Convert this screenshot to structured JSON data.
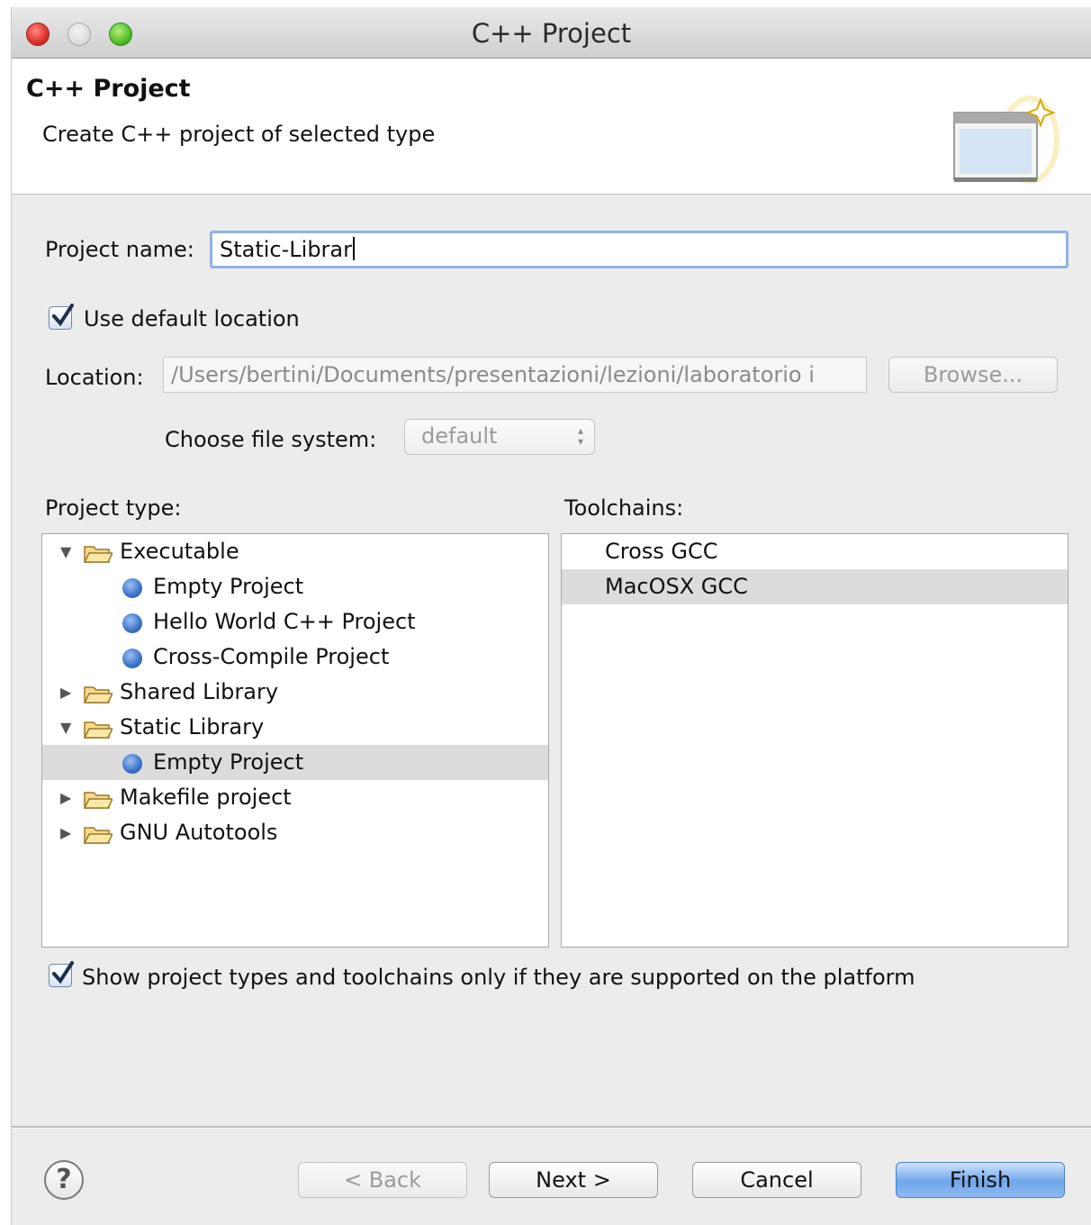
{
  "window": {
    "title": "C++ Project"
  },
  "header": {
    "title": "C++ Project",
    "subtitle": "Create C++ project of selected type"
  },
  "form": {
    "project_name_label": "Project name:",
    "project_name_value": "Static-Librar",
    "use_default_location_label": "Use default location",
    "use_default_location_checked": true,
    "location_label": "Location:",
    "location_value": "/Users/bertini/Documents/presentazioni/lezioni/laboratorio i",
    "browse_label": "Browse...",
    "file_system_label": "Choose file system:",
    "file_system_value": "default"
  },
  "project_type": {
    "label": "Project type:",
    "items": [
      {
        "label": "Executable",
        "kind": "folder",
        "expanded": true
      },
      {
        "label": "Empty Project",
        "kind": "leaf"
      },
      {
        "label": "Hello World C++ Project",
        "kind": "leaf"
      },
      {
        "label": "Cross-Compile Project",
        "kind": "leaf"
      },
      {
        "label": "Shared Library",
        "kind": "folder",
        "expanded": false
      },
      {
        "label": "Static Library",
        "kind": "folder",
        "expanded": true
      },
      {
        "label": "Empty Project",
        "kind": "leaf",
        "selected": true
      },
      {
        "label": "Makefile project",
        "kind": "folder",
        "expanded": false
      },
      {
        "label": "GNU Autotools",
        "kind": "folder",
        "expanded": false
      }
    ]
  },
  "toolchains": {
    "label": "Toolchains:",
    "items": [
      {
        "label": "Cross GCC"
      },
      {
        "label": "MacOSX GCC",
        "selected": true
      }
    ]
  },
  "show_supported": {
    "label": "Show project types and toolchains only if they are supported on the platform",
    "checked": true
  },
  "buttons": {
    "help": "?",
    "back": "< Back",
    "next": "Next >",
    "cancel": "Cancel",
    "finish": "Finish"
  },
  "colors": {
    "accent": "#6fa6ec",
    "selection": "#dcdcdc",
    "bullet": "#3a70c8"
  }
}
